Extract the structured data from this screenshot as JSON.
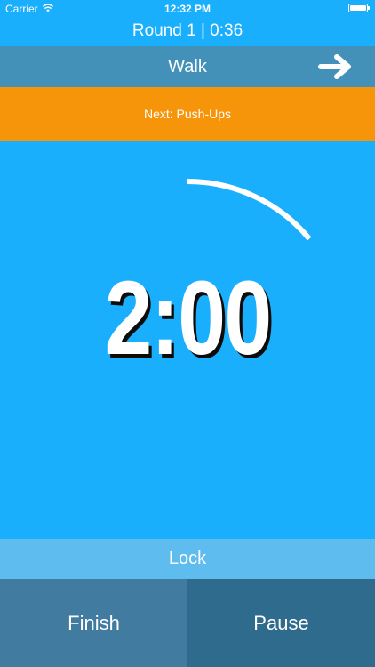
{
  "status_bar": {
    "carrier": "Carrier",
    "time": "12:32 PM",
    "wifi_icon": "wifi-icon",
    "battery_icon": "battery-icon"
  },
  "round_header": "Round 1 | 0:36",
  "exercise": {
    "title": "Walk",
    "next_icon": "arrow-right-icon"
  },
  "next_up": "Next: Push-Ups",
  "timer": {
    "display": "2:00",
    "progress": 0.14
  },
  "lock_label": "Lock",
  "buttons": {
    "finish": "Finish",
    "pause": "Pause"
  },
  "colors": {
    "background": "#1aaffc",
    "exercise_bar": "#4391b9",
    "next_bar": "#f7950a",
    "lock_bar": "#5fbcee",
    "finish_button": "#417ca0",
    "pause_button": "#2f6b8c"
  }
}
